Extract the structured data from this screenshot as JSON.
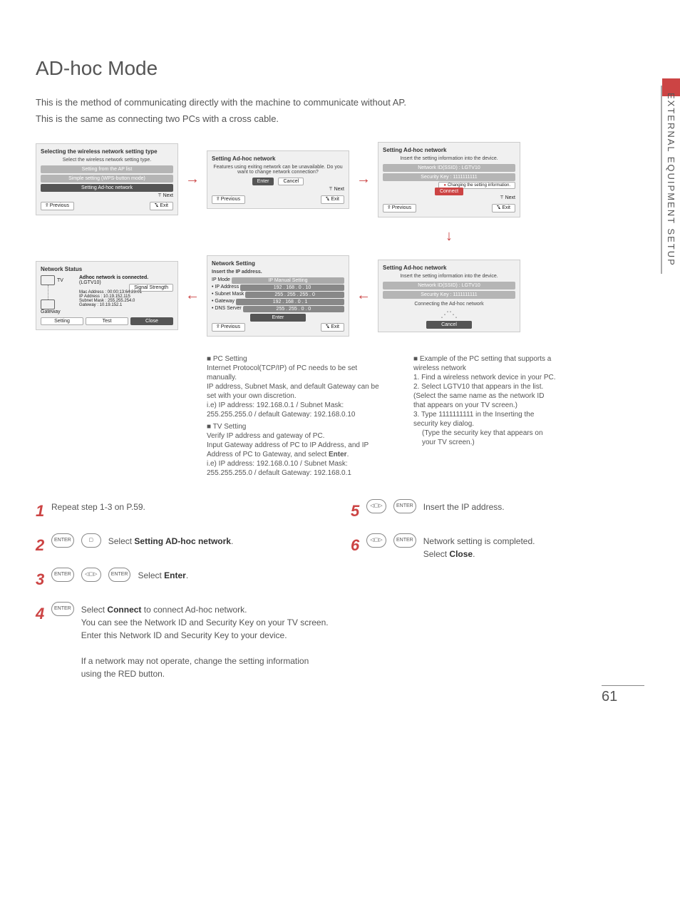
{
  "page": {
    "title": "AD-hoc Mode",
    "intro1": "This is the method of communicating directly with the machine to communicate without AP.",
    "intro2": "This is the same as connecting two PCs with a cross cable.",
    "side_tab": "EXTERNAL EQUIPMENT SETUP",
    "page_number": "61"
  },
  "panel1": {
    "title": "Selecting the wireless network setting type",
    "sub": "Select the wireless network setting type.",
    "opt1": "Setting from the AP list",
    "opt2": "Simple setting (WPS-button mode)",
    "opt3": "Setting Ad-hoc network",
    "next": "ꔉ Next",
    "prev": "ꕉ Previous",
    "exit": "ꔄ Exit"
  },
  "panel2": {
    "title": "Setting Ad-hoc network",
    "sub": "Features using exiting network can be unavailable. Do you want to change network connection?",
    "enter": "Enter",
    "cancel": "Cancel",
    "next": "ꔉ Next",
    "prev": "ꕉ Previous",
    "exit": "ꔄ Exit"
  },
  "panel3": {
    "title": "Setting Ad-hoc network",
    "sub": "Insert the setting information into the device.",
    "ssid": "Network ID(SSID) : LGTV10",
    "key": "Security Key : 1111111111",
    "change": "Changing the setting information.",
    "connect": "Connect",
    "next": "ꔉ Next",
    "prev": "ꕉ Previous",
    "exit": "ꔄ Exit"
  },
  "panel4": {
    "title": "Setting Ad-hoc network",
    "sub": "Insert the setting information into the device.",
    "ssid": "Network ID(SSID) : LGTV10",
    "key": "Security Key : 1111111111",
    "connecting": "Connecting the Ad-hoc network",
    "cancel": "Cancel"
  },
  "panel5": {
    "title": "Network Setting",
    "sub": "Insert the IP address.",
    "mode_label": "IP Mode",
    "mode_value": "IP Manual Setting",
    "ip_label": "• IP Address",
    "ip_value": "192 . 168 . 0 . 10",
    "subnet_label": "• Subnet Mask",
    "subnet_value": "255 . 255 . 255 . 0",
    "gateway_label": "• Gateway",
    "gateway_value": "192 . 168 . 0 . 1",
    "dns_label": "• DNS Server",
    "dns_value": "255 . 255 . 0 . 0",
    "enter": "Enter",
    "prev": "ꕉ Previous",
    "exit": "ꔄ Exit"
  },
  "panel6": {
    "title": "Network Status",
    "connected": "Adhoc network is connected.",
    "name": "(LGTV10)",
    "signal": "Signal Strength",
    "mac": "Mac Address : 00:00:13:64:23:01",
    "ip": "IP Address   : 10.19.152.115",
    "subnet": "Subnet Mask : 255.255.254.0",
    "gateway": "Gateway     : 10.19.152.1",
    "tv_label": "TV",
    "gw_label": "Gateway",
    "setting": "Setting",
    "test": "Test",
    "close": "Close"
  },
  "middle_notes": {
    "pc_head": "■ PC Setting",
    "pc1": "Internet Protocol(TCP/IP) of PC needs to be set manually.",
    "pc2": "IP address, Subnet Mask, and default Gateway can be set with your own discretion.",
    "pc3": "i.e) IP address: 192.168.0.1 / Subnet Mask: 255.255.255.0 / default Gateway: 192.168.0.10",
    "tv_head": "■ TV Setting",
    "tv1": "Verify IP address and gateway of PC.",
    "tv2_a": "Input Gateway address of PC to IP Address, and IP Address of PC to Gateway, and select ",
    "tv2_b": "Enter",
    "tv2_c": ".",
    "tv3": "i.e) IP address: 192.168.0.10 / Subnet Mask: 255.255.255.0 / default Gateway: 192.168.0.1"
  },
  "right_notes": {
    "head": "■ Example of the PC setting that supports a wireless network",
    "n1": "1. Find a wireless network device in your PC.",
    "n2": "2. Select LGTV10 that appears in the list. (Select the same name as the network ID that appears on your TV screen.)",
    "n3": "3. Type 1111111111 in the Inserting the security key dialog.",
    "n4": "(Type the security key that appears on your TV screen.)"
  },
  "steps": {
    "s1": "Repeat step 1-3 on P.59.",
    "s2_a": "Select ",
    "s2_b": "Setting AD-hoc network",
    "s2_c": ".",
    "s3_a": "Select ",
    "s3_b": "Enter",
    "s3_c": ".",
    "s4_a": "Select ",
    "s4_b": "Connect",
    "s4_c": " to connect Ad-hoc network.",
    "s4_d": "You can see the Network ID and Security Key on your TV screen.",
    "s4_e": "Enter this Network ID and Security Key to your device.",
    "s4_f": "If a network may not operate, change the setting information using the RED button.",
    "s5": "Insert the IP address.",
    "s6_a": "Network setting is completed.",
    "s6_b": "Select ",
    "s6_c": "Close",
    "s6_d": ".",
    "enter_btn": "ENTER",
    "nav_btn": "◦"
  }
}
